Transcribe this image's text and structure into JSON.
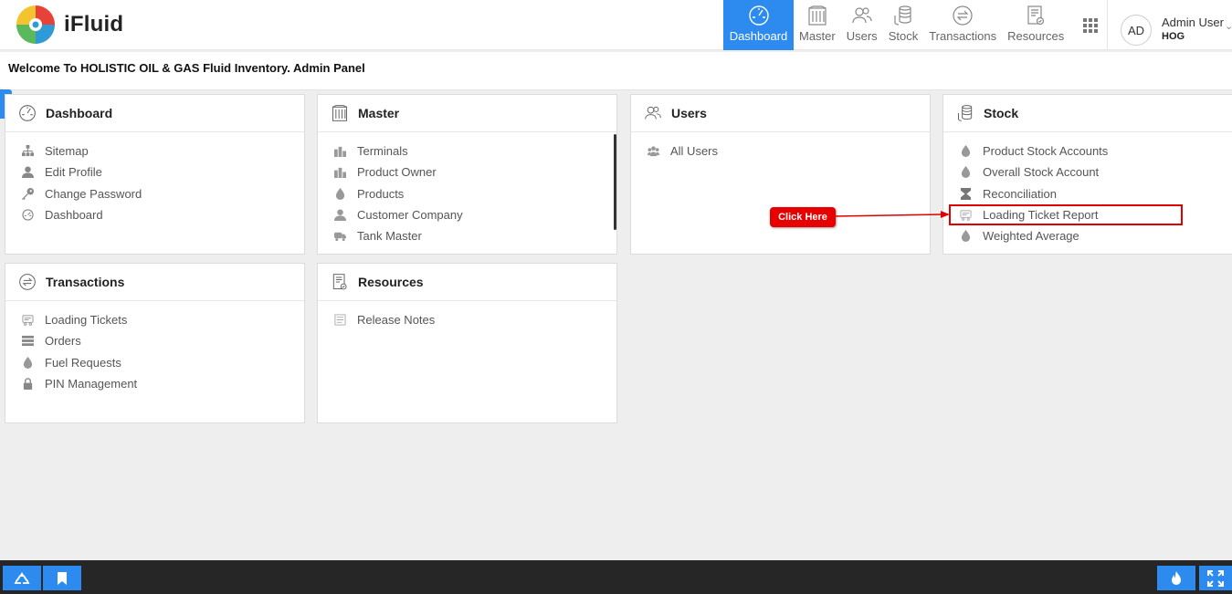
{
  "app": {
    "name": "iFluid"
  },
  "nav": {
    "items": [
      {
        "label": "Dashboard",
        "icon": "dashboard-icon",
        "active": true
      },
      {
        "label": "Master",
        "icon": "building-icon"
      },
      {
        "label": "Users",
        "icon": "users-icon"
      },
      {
        "label": "Stock",
        "icon": "coins-stack-icon"
      },
      {
        "label": "Transactions",
        "icon": "exchange-icon"
      },
      {
        "label": "Resources",
        "icon": "document-icon"
      }
    ]
  },
  "user": {
    "initials": "AD",
    "name": "Admin User",
    "org": "HOG"
  },
  "welcome": "Welcome To HOLISTIC OIL & GAS Fluid Inventory. Admin Panel",
  "cards": [
    {
      "title": "Dashboard",
      "items": [
        "Sitemap",
        "Edit Profile",
        "Change Password",
        "Dashboard"
      ]
    },
    {
      "title": "Master",
      "items": [
        "Terminals",
        "Product Owner",
        "Products",
        "Customer Company",
        "Tank Master"
      ]
    },
    {
      "title": "Users",
      "items": [
        "All Users"
      ]
    },
    {
      "title": "Stock",
      "items": [
        "Product Stock Accounts",
        "Overall Stock Account",
        "Reconciliation",
        "Loading Ticket Report",
        "Weighted Average"
      ]
    },
    {
      "title": "Transactions",
      "items": [
        "Loading Tickets",
        "Orders",
        "Fuel Requests",
        "PIN Management"
      ]
    },
    {
      "title": "Resources",
      "items": [
        "Release Notes"
      ]
    }
  ],
  "annotation": {
    "label": "Click Here"
  },
  "colors": {
    "accent": "#2d8bf0",
    "annotation": "#e80000",
    "footer": "#262626"
  }
}
